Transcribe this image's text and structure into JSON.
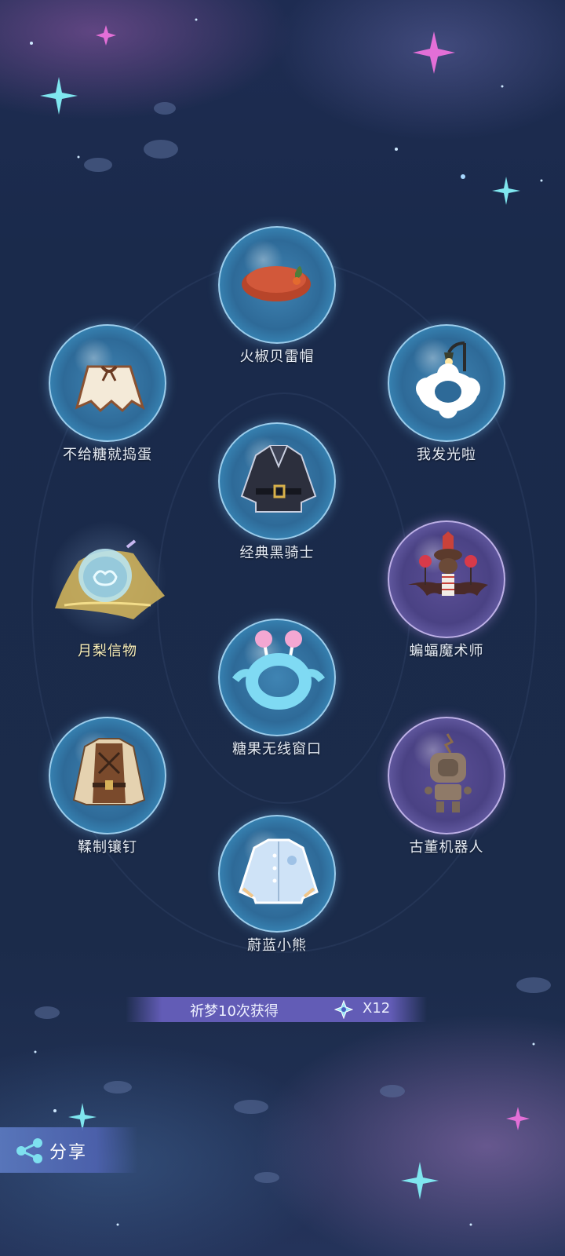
{
  "items": [
    {
      "id": "hat",
      "name": "火椒贝雷帽",
      "bubble": "blue",
      "icon": "beret-icon"
    },
    {
      "id": "cape",
      "name": "不给糖就捣蛋",
      "bubble": "blue",
      "icon": "cape-icon"
    },
    {
      "id": "glow",
      "name": "我发光啦",
      "bubble": "blue",
      "icon": "cloud-lamp-icon"
    },
    {
      "id": "coat",
      "name": "经典黑骑士",
      "bubble": "blue",
      "icon": "black-coat-icon"
    },
    {
      "id": "token",
      "name": "月梨信物",
      "bubble": "gold",
      "icon": "pear-token-icon"
    },
    {
      "id": "bat",
      "name": "蝙蝠魔术师",
      "bubble": "purple",
      "icon": "bat-magician-icon"
    },
    {
      "id": "candy",
      "name": "糖果无线窗口",
      "bubble": "blue",
      "icon": "candy-frame-icon"
    },
    {
      "id": "vest",
      "name": "鞣制镶钉",
      "bubble": "blue",
      "icon": "leather-jacket-icon"
    },
    {
      "id": "robot",
      "name": "古董机器人",
      "bubble": "purple",
      "icon": "robot-icon"
    },
    {
      "id": "bear",
      "name": "蔚蓝小熊",
      "bubble": "blue",
      "icon": "blue-jacket-icon"
    }
  ],
  "reward": {
    "text": "祈梦10次获得",
    "icon": "star-crystal-icon",
    "count": "X12"
  },
  "share": {
    "label": "分享",
    "icon": "share-icon"
  },
  "colors": {
    "background": "#1b2a4a",
    "bubble_blue": "#3f84b3",
    "bubble_purple": "#5b4f96",
    "reward_bar": "#6e64c8",
    "share_button": "#5a78be"
  }
}
